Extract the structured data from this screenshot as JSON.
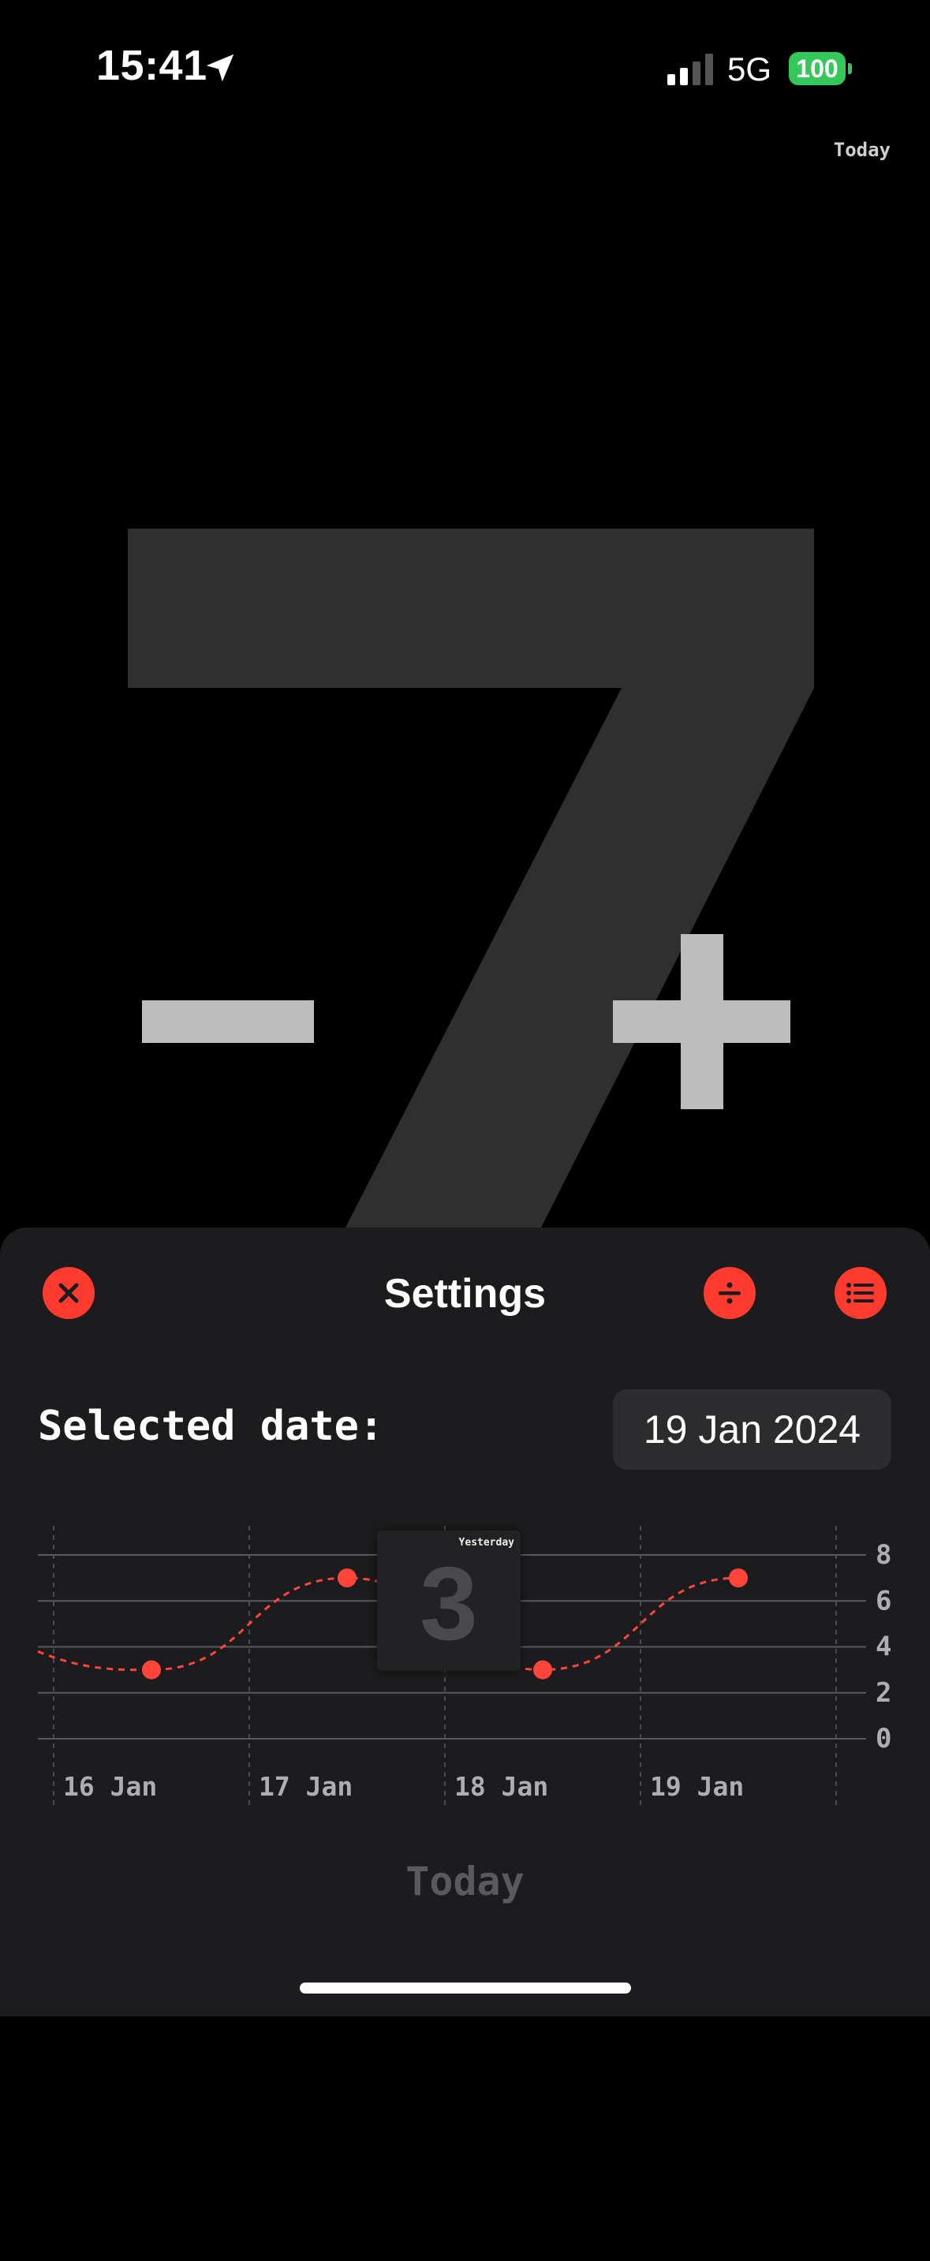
{
  "status_bar": {
    "time": "15:41",
    "network": "5G",
    "battery": "100"
  },
  "header": {
    "today_label": "Today"
  },
  "counter": {
    "value": "7",
    "minus_label": "decrement",
    "plus_label": "increment"
  },
  "settings": {
    "title": "Settings",
    "close_icon": "close-icon",
    "divide_icon": "divide-icon",
    "list_icon": "list-icon",
    "selected_date_label": "Selected date:",
    "selected_date_value": "19 Jan 2024"
  },
  "chart_data": {
    "type": "line",
    "x": [
      "16 Jan",
      "17 Jan",
      "18 Jan",
      "19 Jan"
    ],
    "series": [
      {
        "values": [
          3,
          7,
          3,
          7
        ]
      }
    ],
    "ylim": [
      0,
      8
    ],
    "y_ticks": [
      "0",
      "2",
      "4",
      "6",
      "8"
    ],
    "grid": true,
    "line_style": "dashed",
    "color": "#ff453a",
    "tooltip": {
      "label": "Yesterday",
      "value": "3"
    }
  },
  "footer": {
    "today_button": "Today"
  }
}
